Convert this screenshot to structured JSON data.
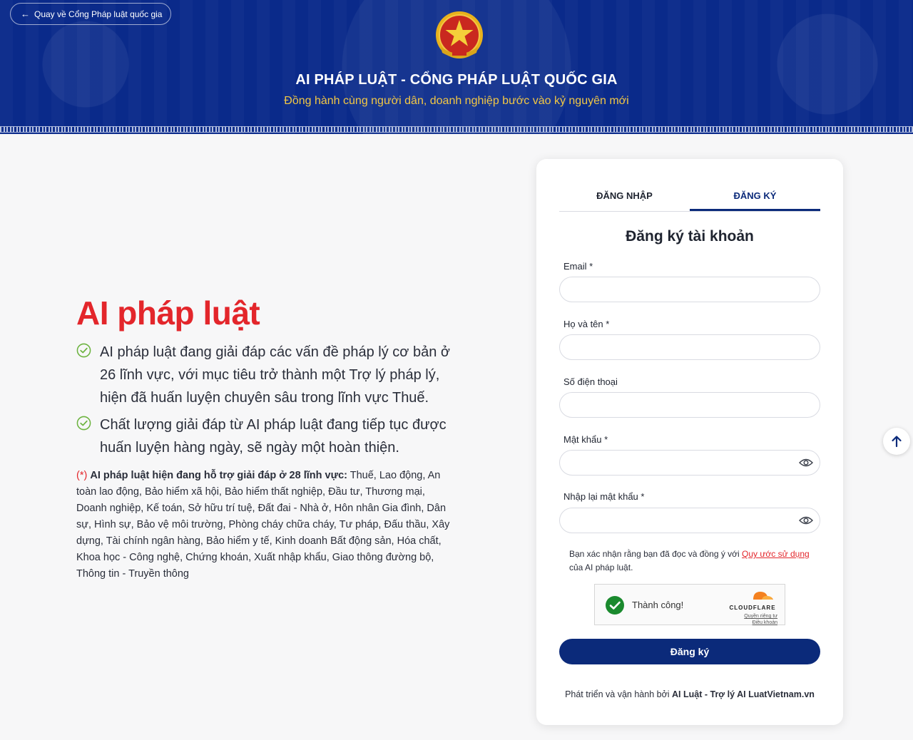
{
  "header": {
    "back_label": "Quay về Cổng Pháp luật quốc gia",
    "title": "AI PHÁP LUẬT - CỔNG PHÁP LUẬT QUỐC GIA",
    "subtitle": "Đồng hành cùng người dân, doanh nghiệp bước vào kỷ nguyên mới"
  },
  "intro": {
    "title": "AI pháp luật",
    "features": [
      "AI pháp luật đang giải đáp các vấn đề pháp lý cơ bản ở 26 lĩnh vực, với mục tiêu trở thành một Trợ lý pháp lý, hiện đã huấn luyện chuyên sâu trong lĩnh vực Thuế.",
      "Chất lượng giải đáp từ AI pháp luật đang tiếp tục được huấn luyện hàng ngày, sẽ ngày một hoàn thiện."
    ],
    "note_marker": "(*)",
    "note_bold": "AI pháp luật hiện đang hỗ trợ giải đáp ở 28 lĩnh vực:",
    "note_text": " Thuế, Lao động, An toàn lao động, Bảo hiểm xã hội, Bảo hiểm thất nghiệp, Đầu tư, Thương mại, Doanh nghiệp, Kế toán, Sở hữu trí tuệ, Đất đai - Nhà ở, Hôn nhân Gia đình, Dân sự, Hình sự, Bảo vệ môi trường, Phòng cháy chữa cháy, Tư pháp, Đấu thầu, Xây dựng, Tài chính ngân hàng, Bảo hiểm y tế, Kinh doanh Bất động sản, Hóa chất, Khoa học - Công nghệ, Chứng khoán, Xuất nhập khẩu, Giao thông đường bộ, Thông tin - Truyền thông"
  },
  "auth": {
    "tabs": [
      {
        "label": "ĐĂNG NHẬP",
        "active": false
      },
      {
        "label": "ĐĂNG KÝ",
        "active": true
      }
    ],
    "form_title": "Đăng ký tài khoản",
    "fields": {
      "email": {
        "label": "Email *",
        "value": ""
      },
      "fullname": {
        "label": "Họ và tên *",
        "value": ""
      },
      "phone": {
        "label": "Số điện thoại",
        "value": ""
      },
      "password": {
        "label": "Mật khẩu *",
        "value": ""
      },
      "password_confirm": {
        "label": "Nhập lại mật khẩu *",
        "value": ""
      }
    },
    "agree_text": "Bạn xác nhận rằng bạn đã đọc và đồng ý với ",
    "agree_link": "Quy ước sử dụng",
    "agree_suffix": " của AI pháp luật.",
    "captcha": {
      "status": "Thành công!",
      "brand": "CLOUDFLARE",
      "privacy": "Quyền riêng tư",
      "terms": "Điều khoản"
    },
    "submit_label": "Đăng ký",
    "credit_prefix": "Phát triển và vận hành bởi ",
    "credit_bold": "AI Luật - Trợ lý AI LuatVietnam.vn"
  },
  "colors": {
    "header_bg": "#0a2a8a",
    "accent_red": "#e3262b",
    "primary_navy": "#0b2a7a",
    "subtitle_gold": "#f2c744",
    "check_green": "#6cb33f"
  },
  "icons": [
    "arrow-left-icon",
    "national-emblem",
    "check-circle-icon",
    "eye-icon",
    "success-check-icon",
    "cloudflare-logo",
    "arrow-up-icon"
  ]
}
